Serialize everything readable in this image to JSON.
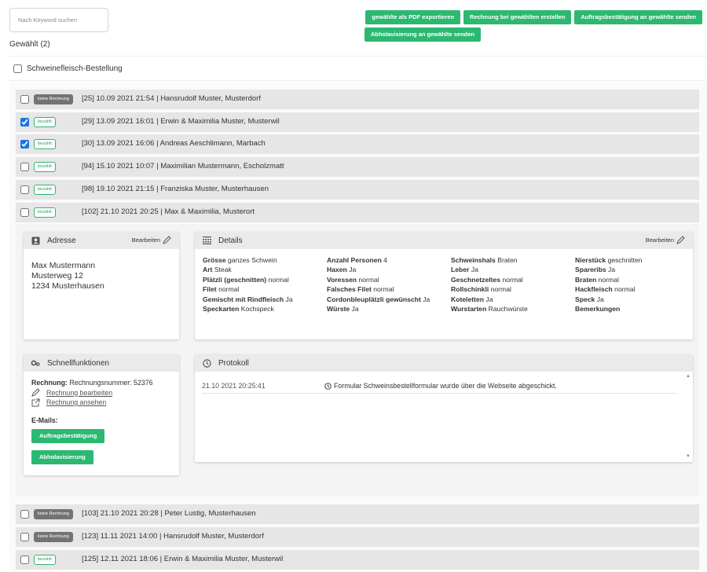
{
  "search": {
    "placeholder": "Nach Keyword suchen"
  },
  "selected_count": "Gewählt (2)",
  "actions": [
    "gewählte als PDF exportieren",
    "Rechnung bei gewählten erstellen",
    "Auftragsbestätigung an gewählte senden",
    "Abholavisierung an gewählte senden"
  ],
  "group": {
    "label": "Schweinefleisch-Bestellung",
    "checked": false
  },
  "orders": [
    {
      "badge": "keine Rechnung",
      "status": "none",
      "checked": false,
      "text": "[25] 10.09 2021 21:54 | Hansrudolf Muster, Musterdorf"
    },
    {
      "badge": "bezahlt",
      "status": "paid",
      "checked": true,
      "text": "[29] 13.09 2021 16:01 | Erwin & Maximilia Muster, Musterwil"
    },
    {
      "badge": "bezahlt",
      "status": "paid",
      "checked": true,
      "text": "[30] 13.09 2021 16:06 | Andreas Aeschlimann, Marbach"
    },
    {
      "badge": "bezahlt",
      "status": "paid",
      "checked": false,
      "text": "[94] 15.10 2021 10:07 | Maximilian Mustermann, Escholzmatt"
    },
    {
      "badge": "bezahlt",
      "status": "paid",
      "checked": false,
      "text": "[98] 19.10 2021 21:15 | Franziska Muster, Musterhausen"
    },
    {
      "badge": "bezahlt",
      "status": "paid",
      "checked": false,
      "text": "[102] 21.10 2021 20:25 | Max & Maximilia, Musterort"
    },
    {
      "badge": "keine Rechnung",
      "status": "none",
      "checked": false,
      "text": "[103] 21.10 2021 20:28 | Peter Lustig, Musterhausen"
    },
    {
      "badge": "keine Rechnung",
      "status": "none",
      "checked": false,
      "text": "[123] 11.11 2021 14:00 | Hansrudolf Muster, Musterdorf"
    },
    {
      "badge": "bezahlt",
      "status": "paid",
      "checked": false,
      "text": "[125] 12.11 2021 18:06 | Erwin & Maximilia Muster, Musterwil"
    }
  ],
  "address_card": {
    "title": "Adresse",
    "edit": "Bearbeiten",
    "lines": [
      "Max Mustermann",
      "Musterweg 12",
      "1234 Musterhausen"
    ]
  },
  "details_card": {
    "title": "Details",
    "edit": "Bearbeiten",
    "columns": [
      [
        {
          "k": "Grösse",
          "v": "ganzes Schwein"
        },
        {
          "k": "Art",
          "v": "Steak"
        },
        {
          "k": "Plätzli (geschnitten)",
          "v": "normal"
        },
        {
          "k": "Filet",
          "v": "normal"
        },
        {
          "k": "Gemischt mit Rindfleisch",
          "v": "Ja"
        },
        {
          "k": "Speckarten",
          "v": "Kochspeck"
        }
      ],
      [
        {
          "k": "Anzahl Personen",
          "v": "4"
        },
        {
          "k": "Haxen",
          "v": "Ja"
        },
        {
          "k": "Voressen",
          "v": "normal"
        },
        {
          "k": "Falsches Filet",
          "v": "normal"
        },
        {
          "k": "Cordonbleuplätzli gewünscht",
          "v": "Ja"
        },
        {
          "k": "Würste",
          "v": "Ja"
        }
      ],
      [
        {
          "k": "Schweinshals",
          "v": "Braten"
        },
        {
          "k": "Leber",
          "v": "Ja"
        },
        {
          "k": "Geschnetzeltes",
          "v": "normal"
        },
        {
          "k": "Rollschinkli",
          "v": "normal"
        },
        {
          "k": "Koteletten",
          "v": "Ja"
        },
        {
          "k": "Wurstarten",
          "v": "Rauchwürste"
        }
      ],
      [
        {
          "k": "Nierstück",
          "v": "geschnitten"
        },
        {
          "k": "Spareribs",
          "v": "Ja"
        },
        {
          "k": "Braten",
          "v": "normal"
        },
        {
          "k": "Hackfleisch",
          "v": "normal"
        },
        {
          "k": "Speck",
          "v": "Ja"
        },
        {
          "k": "Bemerkungen",
          "v": ""
        }
      ]
    ]
  },
  "quick_card": {
    "title": "Schnellfunktionen",
    "invoice_label": "Rechnung:",
    "invoice_number": "Rechnungsnummer: 52376",
    "edit_link": "Rechnung bearbeiten",
    "view_link": "Rechnung ansehen",
    "emails_label": "E-Mails:",
    "btn_confirm": "Auftragsbestätigung",
    "btn_pickup": "Abholavisierung"
  },
  "protocol_card": {
    "title": "Protokoll",
    "entries": [
      {
        "time": "21.10 2021 20:25:41",
        "message": "Formular Schweinsbestellformular wurde über die Webseite abgeschickt."
      }
    ]
  },
  "colors": {
    "accent_green": "#2cb871",
    "badge_gray": "#737373",
    "row_bg": "#e6e6e6"
  }
}
